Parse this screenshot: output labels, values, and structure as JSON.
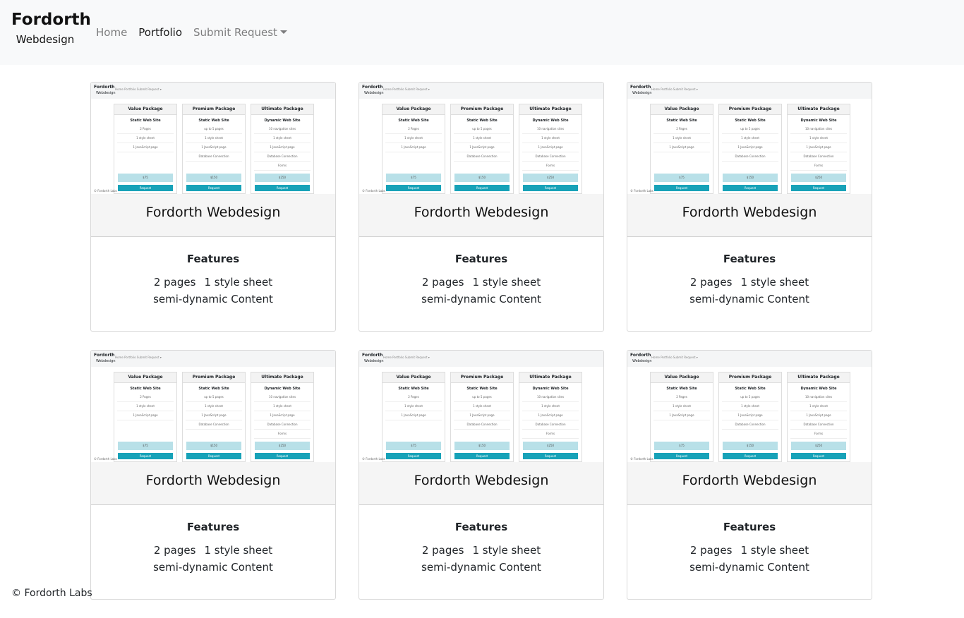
{
  "navbar": {
    "brand_title": "Fordorth",
    "brand_subtitle": "Webdesign",
    "links": [
      {
        "label": "Home"
      },
      {
        "label": "Portfolio"
      },
      {
        "label": "Submit Request"
      }
    ]
  },
  "thumbnail": {
    "brand_title": "Fordorth",
    "brand_subtitle": "Webdesign",
    "nav_text": "Home   Portfolio   Submit Request ▾",
    "footer": "© Fordorth Labs",
    "packages": [
      {
        "header": "Value Package",
        "title": "Static Web Site",
        "items": [
          "2 Pages",
          "1 style sheet",
          "1 JavaScript page"
        ],
        "price": "$75",
        "button": "Request"
      },
      {
        "header": "Premium Package",
        "title": "Static Web Site",
        "items": [
          "up to 5 pages",
          "1 style sheet",
          "1 JavaScript page",
          "Database Connection"
        ],
        "price": "$150",
        "button": "Request"
      },
      {
        "header": "Ultimate Package",
        "title": "Dynamic Web Site",
        "items": [
          "10 navigation sites",
          "1 style sheet",
          "1 JavaScript page",
          "Database Connection",
          "Forms"
        ],
        "price": "$250",
        "button": "Request"
      }
    ]
  },
  "cards": [
    {
      "title": "Fordorth Webdesign",
      "features_title": "Features",
      "feature_pages": "2 pages",
      "feature_style": "1 style sheet",
      "feature_content": "semi-dynamic Content"
    },
    {
      "title": "Fordorth Webdesign",
      "features_title": "Features",
      "feature_pages": "2 pages",
      "feature_style": "1 style sheet",
      "feature_content": "semi-dynamic Content"
    },
    {
      "title": "Fordorth Webdesign",
      "features_title": "Features",
      "feature_pages": "2 pages",
      "feature_style": "1 style sheet",
      "feature_content": "semi-dynamic Content"
    },
    {
      "title": "Fordorth Webdesign",
      "features_title": "Features",
      "feature_pages": "2 pages",
      "feature_style": "1 style sheet",
      "feature_content": "semi-dynamic Content"
    },
    {
      "title": "Fordorth Webdesign",
      "features_title": "Features",
      "feature_pages": "2 pages",
      "feature_style": "1 style sheet",
      "feature_content": "semi-dynamic Content"
    },
    {
      "title": "Fordorth Webdesign",
      "features_title": "Features",
      "feature_pages": "2 pages",
      "feature_style": "1 style sheet",
      "feature_content": "semi-dynamic Content"
    }
  ],
  "footer": {
    "text": "© Fordorth Labs"
  },
  "colors": {
    "navbar_bg": "#f8f9fa",
    "accent": "#17a2b8"
  }
}
